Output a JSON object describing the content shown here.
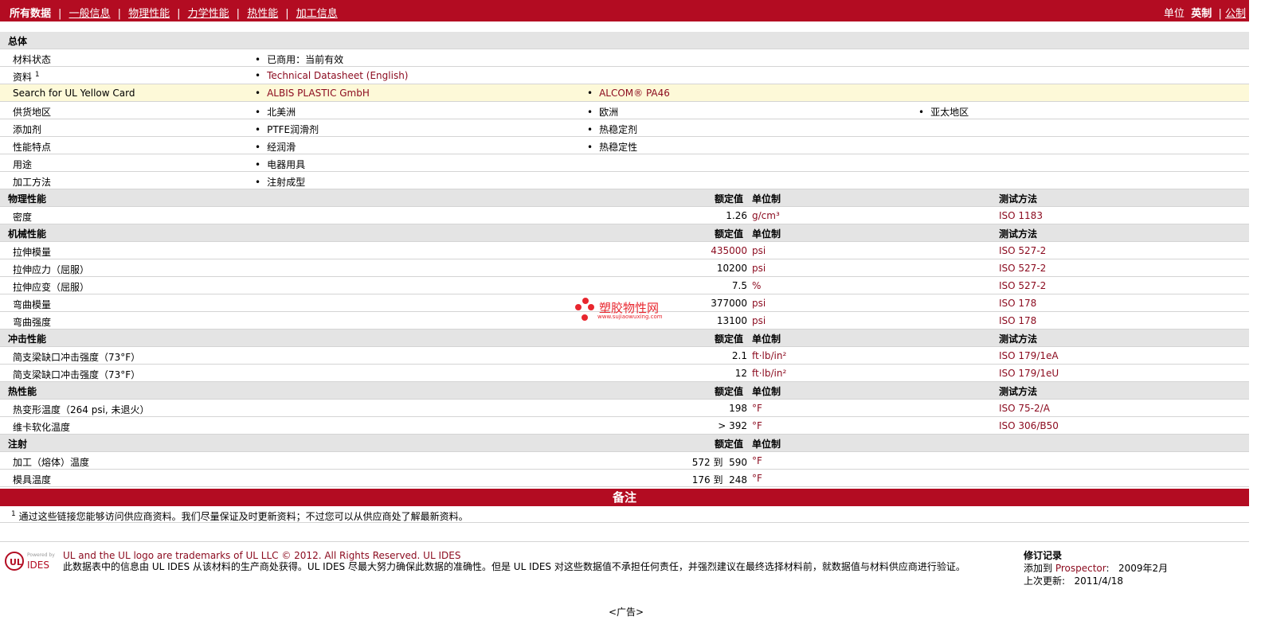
{
  "nav": {
    "items": [
      "所有数据",
      "一般信息",
      "物理性能",
      "力学性能",
      "热性能",
      "加工信息"
    ],
    "units_label": "单位",
    "unit_english": "英制",
    "unit_metric": "公制"
  },
  "general": {
    "header": "总体",
    "rows": [
      {
        "label": "材料状态",
        "values": [
          "已商用：当前有效"
        ]
      },
      {
        "label": "资料",
        "sup": "1",
        "values": [
          "Technical Datasheet (English)"
        ]
      },
      {
        "label": "Search for UL Yellow Card",
        "values": [
          "ALBIS PLASTIC GmbH",
          "ALCOM® PA46"
        ]
      },
      {
        "label": "供货地区",
        "values": [
          "北美洲",
          "欧洲",
          "亚太地区"
        ]
      },
      {
        "label": "添加剂",
        "values": [
          "PTFE润滑剂",
          "热稳定剂"
        ]
      },
      {
        "label": "性能特点",
        "values": [
          "经润滑",
          "热稳定性"
        ]
      },
      {
        "label": "用途",
        "values": [
          "电器用具"
        ]
      },
      {
        "label": "加工方法",
        "values": [
          "注射成型"
        ]
      }
    ]
  },
  "columns": {
    "rated": "额定值",
    "unit": "单位制",
    "method": "测试方法"
  },
  "sections": [
    {
      "header": "物理性能",
      "has_method": true,
      "rows": [
        {
          "label": "密度",
          "value": "1.26",
          "unit": "g/cm³",
          "method": "ISO 1183"
        }
      ]
    },
    {
      "header": "机械性能",
      "has_method": true,
      "rows": [
        {
          "label": "拉伸模量",
          "value": "435000",
          "unit": "psi",
          "method": "ISO 527-2"
        },
        {
          "label": "拉伸应力（屈服）",
          "value": "10200",
          "unit": "psi",
          "method": "ISO 527-2"
        },
        {
          "label": "拉伸应变（屈服）",
          "value": "7.5",
          "unit": "%",
          "method": "ISO 527-2"
        },
        {
          "label": "弯曲模量",
          "value": "377000",
          "unit": "psi",
          "method": "ISO 178"
        },
        {
          "label": "弯曲强度",
          "value": "13100",
          "unit": "psi",
          "method": "ISO 178"
        }
      ]
    },
    {
      "header": "冲击性能",
      "has_method": true,
      "rows": [
        {
          "label": "简支梁缺口冲击强度（73°F）",
          "value": "2.1",
          "unit": "ft·lb/in²",
          "method": "ISO 179/1eA"
        },
        {
          "label": "简支梁缺口冲击强度（73°F）",
          "value": "12",
          "unit": "ft·lb/in²",
          "method": "ISO 179/1eU"
        }
      ]
    },
    {
      "header": "热性能",
      "has_method": true,
      "rows": [
        {
          "label": "热变形温度（264 psi, 未退火）",
          "value": "198",
          "unit": "°F",
          "method": "ISO 75-2/A"
        },
        {
          "label": "维卡软化温度",
          "value": "> 392",
          "unit": "°F",
          "method": "ISO 306/B50"
        }
      ]
    },
    {
      "header": "注射",
      "has_method": false,
      "rows": [
        {
          "label": "加工（熔体）温度",
          "value": "572 到  590",
          "unit": "°F",
          "method": ""
        },
        {
          "label": "模具温度",
          "value": "176 到  248",
          "unit": "°F",
          "method": ""
        }
      ]
    }
  ],
  "notes": {
    "header": "备注",
    "sup": "1",
    "text": "通过这些链接您能够访问供应商资料。我们尽量保证及时更新资料；不过您可以从供应商处了解最新资料。"
  },
  "watermark": {
    "title": "塑胶物性网",
    "url": "www.sujiaowuxing.com"
  },
  "footer": {
    "logo_powered": "Powered by",
    "logo_ul": "UL",
    "logo_ides": "IDES",
    "line1": "UL and the UL logo are trademarks of UL LLC © 2012. All Rights Reserved. UL IDES",
    "line2": "此数据表中的信息由 UL IDES 从该材料的生产商处获得。UL IDES 尽最大努力确保此数据的准确性。但是 UL IDES 对这些数据值不承担任何责任，并强烈建议在最终选择材料前，就数据值与材料供应商进行验证。",
    "revision_title": "修订记录",
    "added_label": "添加到",
    "added_source": "Prospector",
    "added_date": "2009年2月",
    "updated_label": "上次更新:",
    "updated_date": "2011/4/18"
  },
  "ad": "<广告>",
  "colors": {
    "brand": "#b30c22",
    "link": "#8b0a1e",
    "header_bg": "#e4e4e4",
    "highlight": "#fdf9d8"
  }
}
